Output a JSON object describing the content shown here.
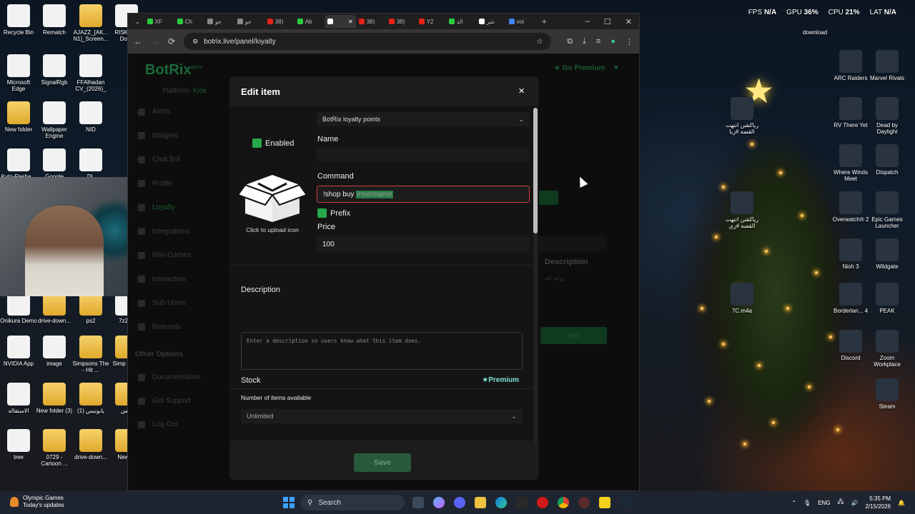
{
  "perf": {
    "fps_label": "FPS",
    "fps_value": "N/A",
    "gpu_label": "GPU",
    "gpu_value": "36%",
    "cpu_label": "CPU",
    "cpu_value": "21%",
    "lat_label": "LAT",
    "lat_value": "N/A"
  },
  "desktop_left": [
    {
      "label": "Recycle Bin",
      "icon": "recycle-bin-icon"
    },
    {
      "label": "Rematch",
      "icon": "document-icon"
    },
    {
      "label": "AJAZZ_[AK... N1]_Screen...",
      "icon": "folder-icon"
    },
    {
      "label": "RISK C... Domi",
      "icon": "game-icon"
    },
    {
      "label": "Microsoft Edge",
      "icon": "edge-icon"
    },
    {
      "label": "SignalRgb",
      "icon": "signalrgb-icon"
    },
    {
      "label": "FFAlhadan CV_(2026)_",
      "icon": "pdf-icon"
    },
    {
      "label": "New folder",
      "icon": "folder-icon"
    },
    {
      "label": "Wallpaper Engine",
      "icon": "wallpaper-engine-icon"
    },
    {
      "label": "NID",
      "icon": "document-icon"
    },
    {
      "label": "Kyto-Resha...",
      "icon": "document-icon"
    },
    {
      "label": "Google",
      "icon": "chrome-icon"
    },
    {
      "label": "DL",
      "icon": "document-icon"
    },
    {
      "label": "Onikura Demo",
      "icon": "game-icon"
    },
    {
      "label": "drive-down...",
      "icon": "folder-icon"
    },
    {
      "label": "ps2",
      "icon": "folder-icon"
    },
    {
      "label": "7z250",
      "icon": "archive-icon"
    },
    {
      "label": "NVIDIA App",
      "icon": "nvidia-icon"
    },
    {
      "label": "image",
      "icon": "image-icon"
    },
    {
      "label": "Simpsons The - Hit ...",
      "icon": "folder-icon"
    },
    {
      "label": "Simp The -",
      "icon": "folder-icon"
    },
    {
      "label": "الاستقالة",
      "icon": "document-icon"
    },
    {
      "label": "New folder (3)",
      "icon": "folder-icon"
    },
    {
      "label": "يابونيس (1)",
      "icon": "folder-icon"
    },
    {
      "label": "بوس",
      "icon": "folder-icon"
    },
    {
      "label": "tree",
      "icon": "image-icon"
    },
    {
      "label": "0729 - Cartoon ...",
      "icon": "folder-icon"
    },
    {
      "label": "drive-down...",
      "icon": "folder-icon"
    },
    {
      "label": "New f (",
      "icon": "folder-icon"
    }
  ],
  "desktop_right": [
    {
      "label": "download",
      "icon": "folder-icon"
    },
    {
      "label": "ARC Raiders",
      "icon": "arc-raiders-icon"
    },
    {
      "label": "Marvel Rivals",
      "icon": "marvel-rivals-icon"
    },
    {
      "label": "رياكشن انتهت القصة #زبا",
      "icon": "video-icon"
    },
    {
      "label": "RV There Yet",
      "icon": "game-icon"
    },
    {
      "label": "Dead by Daylight",
      "icon": "dbd-icon"
    },
    {
      "label": "Where Winds Meet",
      "icon": "game-icon"
    },
    {
      "label": "Dispatch",
      "icon": "game-icon"
    },
    {
      "label": "رياكشن انتهت القصة #زي",
      "icon": "video-icon"
    },
    {
      "label": "Overwatch® 2",
      "icon": "overwatch-icon"
    },
    {
      "label": "Epic Games Launcher",
      "icon": "epic-icon"
    },
    {
      "label": "Nioh 3",
      "icon": "game-icon"
    },
    {
      "label": "Wildgate",
      "icon": "game-icon"
    },
    {
      "label": "7C.m4a",
      "icon": "audio-icon"
    },
    {
      "label": "Borderlan... 4",
      "icon": "game-icon"
    },
    {
      "label": "PEAK",
      "icon": "game-icon"
    },
    {
      "label": "Discord",
      "icon": "discord-icon"
    },
    {
      "label": "Zoom Workplace",
      "icon": "zoom-icon"
    },
    {
      "label": "Steam",
      "icon": "steam-icon"
    }
  ],
  "browser": {
    "tabs": [
      {
        "label": "XF",
        "color": "#2ecc40"
      },
      {
        "label": "Ch",
        "color": "#2ecc40"
      },
      {
        "label": "جو",
        "color": "#888888"
      },
      {
        "label": "جو",
        "color": "#888888"
      },
      {
        "label": "38)",
        "color": "#e62117"
      },
      {
        "label": "Ab",
        "color": "#2ecc40"
      },
      {
        "label": "",
        "color": "#ffffff",
        "active": true
      },
      {
        "label": "38)",
        "color": "#e62117"
      },
      {
        "label": "38)",
        "color": "#e62117"
      },
      {
        "label": "Y2",
        "color": "#e62117"
      },
      {
        "label": "الد",
        "color": "#2ecc40"
      },
      {
        "label": "شر",
        "color": "#ffffff"
      },
      {
        "label": "voi",
        "color": "#4285f4"
      }
    ],
    "new_tab": "+",
    "url": "botrix.live/panel/loyalty",
    "minimize": "–",
    "maximize": "☐",
    "close": "✕"
  },
  "botrix": {
    "brand": "BotRix",
    "brand_badge": "BETA",
    "platform_label": "Platform:",
    "platform_value": "Kick",
    "go_premium": "Go Premium",
    "sidebar": [
      {
        "label": "Alerts",
        "icon": "alert-icon"
      },
      {
        "label": "Widgets",
        "icon": "widgets-icon"
      },
      {
        "label": "Chat Bot",
        "icon": "chatbot-icon"
      },
      {
        "label": "Profile",
        "icon": "profile-icon"
      },
      {
        "label": "Loyalty",
        "icon": "loyalty-icon",
        "active": true
      },
      {
        "label": "Integrations",
        "icon": "integrations-icon"
      },
      {
        "label": "Mini-Games",
        "icon": "minigames-icon"
      },
      {
        "label": "Interaction",
        "icon": "interaction-icon"
      },
      {
        "label": "Sub-Users",
        "icon": "subusers-icon"
      },
      {
        "label": "Referrals",
        "icon": "referrals-icon"
      }
    ],
    "other_options": "Other Options",
    "other_items": [
      {
        "label": "Documentation",
        "icon": "documentation-icon"
      },
      {
        "label": "Get Support",
        "icon": "support-icon"
      },
      {
        "label": "Log Out",
        "icon": "logout-icon"
      }
    ],
    "bg_description": "Description",
    "bg_description_sub": "رواية لله",
    "bg_edit": "Edit"
  },
  "modal": {
    "title": "Edit item",
    "close": "×",
    "currency_select": "BotRix loyalty points",
    "enabled_label": "Enabled",
    "upload_text": "Click to upload icon",
    "name_label": "Name",
    "name_value": "",
    "command_label": "Command",
    "command_prefix": "!shop buy",
    "command_highlight": "insertname",
    "prefix_label": "Prefix",
    "price_label": "Price",
    "price_value": "100",
    "description_label": "Description",
    "description_placeholder": "Enter a description so users know what this item does.",
    "stock_label": "Stock",
    "premium_label": "Premium",
    "items_available_label": "Number of items available",
    "stock_select": "Unlimited",
    "save": "Save"
  },
  "taskbar": {
    "news_title": "Olympic Games",
    "news_sub": "Today's updates",
    "search": "Search",
    "lang": "ENG",
    "time": "5:35 PM",
    "date": "2/15/2026"
  }
}
